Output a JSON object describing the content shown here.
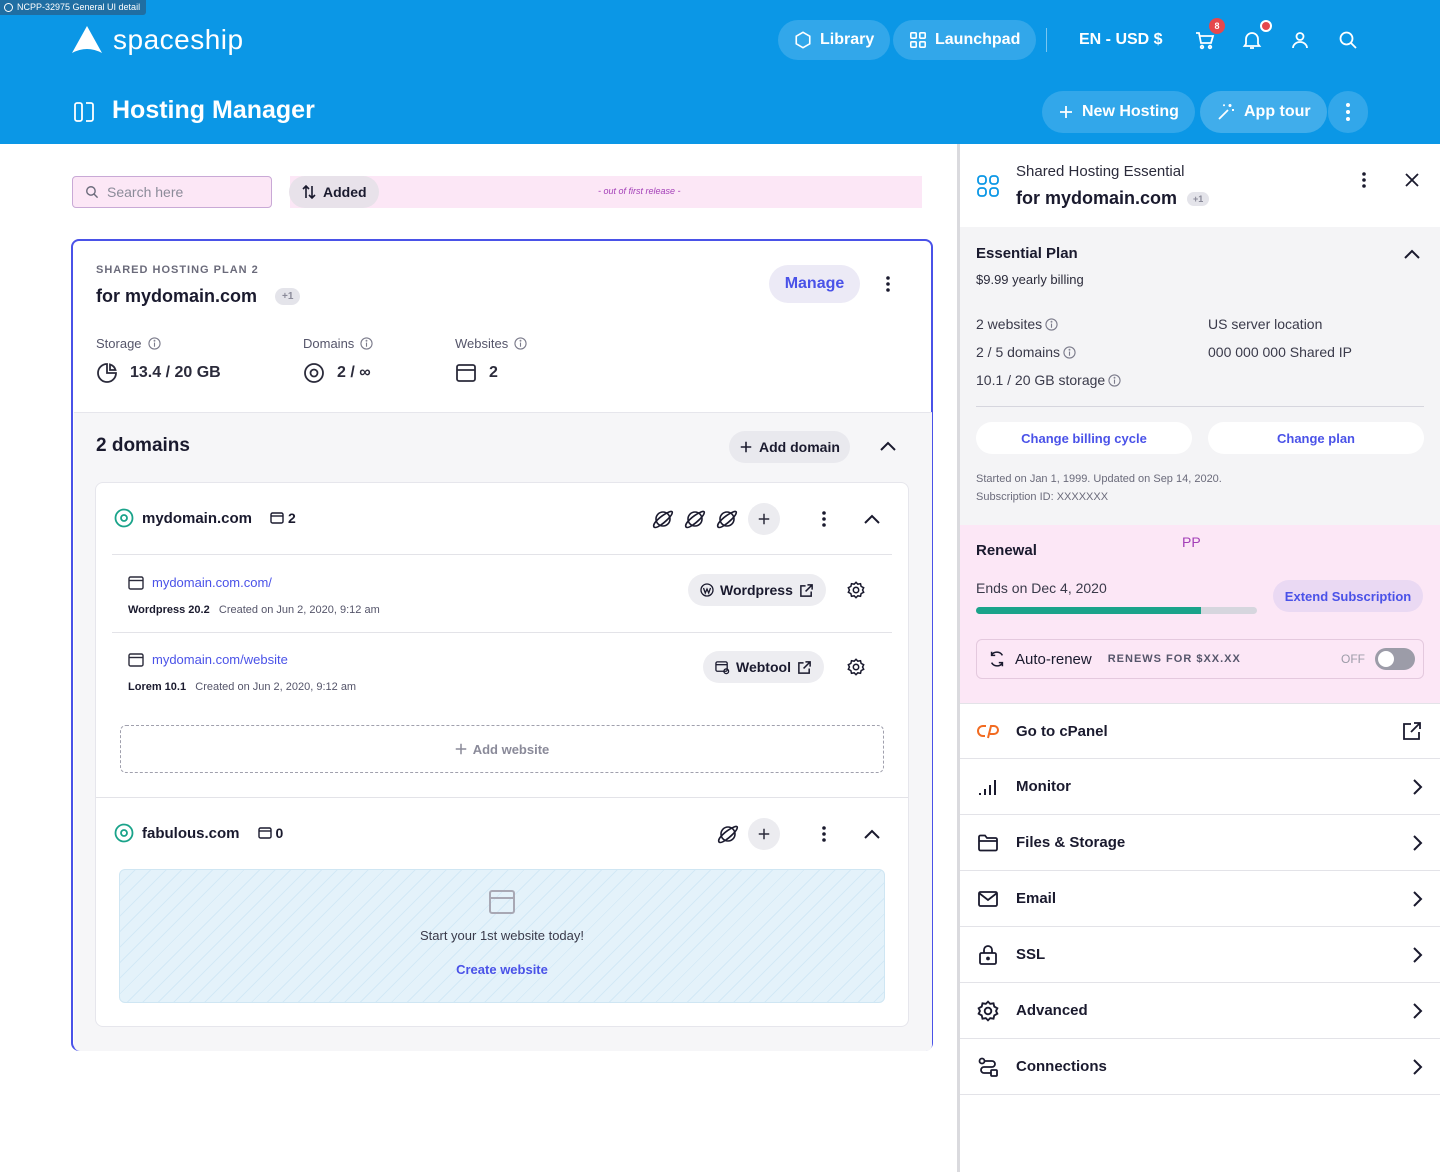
{
  "frame_label": "NCPP-32975 General UI detail",
  "brand": {
    "name": "spaceship"
  },
  "nav": {
    "library": "Library",
    "launchpad": "Launchpad",
    "locale": "EN - USD $",
    "cart_count": "8"
  },
  "page": {
    "title": "Hosting Manager",
    "new_hosting": "New Hosting",
    "app_tour": "App tour"
  },
  "toolbar": {
    "search_placeholder": "Search here",
    "sort_label": "Added",
    "note": "- out of first release -"
  },
  "plan_card": {
    "caption": "SHARED HOSTING PLAN 2",
    "domain": "for mydomain.com",
    "extra": "+1",
    "manage": "Manage",
    "stats": [
      {
        "label": "Storage",
        "value": "13.4 / 20  GB"
      },
      {
        "label": "Domains",
        "value": "2 / ∞"
      },
      {
        "label": "Websites",
        "value": "2"
      }
    ],
    "domains_title": "2 domains",
    "add_domain": "Add domain"
  },
  "domains": [
    {
      "name": "mydomain.com",
      "count": "2",
      "sites": [
        {
          "url": "mydomain.com.com/",
          "app": "Wordpress 20.2",
          "created": "Created on Jun 2, 2020, 9:12 am",
          "tool": "Wordpress"
        },
        {
          "url": "mydomain.com/website",
          "app": "Lorem 10.1",
          "created": "Created on Jun 2, 2020, 9:12 am",
          "tool": "Webtool"
        }
      ],
      "add_website": "Add website"
    },
    {
      "name": "fabulous.com",
      "count": "0",
      "empty_text": "Start your 1st website today!",
      "create": "Create website"
    }
  ],
  "panel": {
    "subtitle": "Shared Hosting Essential",
    "domain": "for mydomain.com",
    "extra": "+1",
    "plan_name": "Essential Plan",
    "billing": "$9.99 yearly billing",
    "specs_left": [
      "2 websites",
      "2 / 5 domains",
      "10.1 / 20 GB storage"
    ],
    "specs_right": [
      "US server location",
      "000 000 000 Shared IP"
    ],
    "change_billing": "Change billing cycle",
    "change_plan": "Change plan",
    "started": "Started on Jan 1, 1999. Updated on Sep 14, 2020.",
    "subscription": "Subscription ID: XXXXXXX",
    "renewal_title": "Renewal",
    "pp": "PP",
    "ends": "Ends on Dec 4, 2020",
    "renewal_progress": 0.8,
    "extend": "Extend Subscription",
    "autorenew": "Auto-renew",
    "renews_for": "RENEWS FOR $XX.XX",
    "toggle_state": "OFF",
    "menu": [
      "Go to cPanel",
      "Monitor",
      "Files & Storage",
      "Email",
      "SSL",
      "Advanced",
      "Connections"
    ]
  },
  "colors": {
    "header": "#0b97e6",
    "accent": "#4a52e8",
    "teal": "#1aa38a",
    "pink": "#fce7f6"
  }
}
